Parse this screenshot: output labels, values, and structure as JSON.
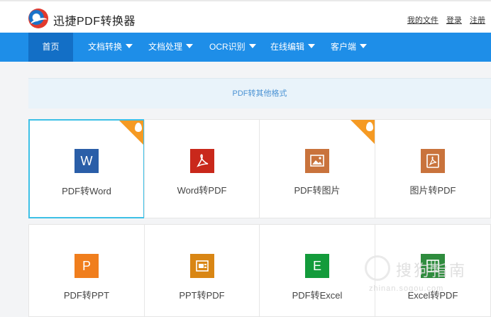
{
  "header": {
    "brand": "迅捷PDF转换器",
    "links": [
      "我的文件",
      "登录",
      "注册"
    ]
  },
  "nav": {
    "items": [
      {
        "label": "首页",
        "active": true,
        "dropdown": false
      },
      {
        "label": "文档转换",
        "dropdown": true
      },
      {
        "label": "文档处理",
        "dropdown": true
      },
      {
        "label": "OCR识别",
        "dropdown": true
      },
      {
        "label": "在线编辑",
        "dropdown": true
      },
      {
        "label": "客户端",
        "dropdown": true
      }
    ]
  },
  "banner": {
    "text": "PDF转其他格式"
  },
  "tools": [
    {
      "label": "PDF转Word",
      "icon": "word-icon",
      "glyph": "W",
      "color": "#2a5ea8",
      "hot": true,
      "selected": true
    },
    {
      "label": "Word转PDF",
      "icon": "pdf-icon",
      "glyph": "",
      "color": "#c9281b",
      "hot": false
    },
    {
      "label": "PDF转图片",
      "icon": "image-icon",
      "glyph": "",
      "color": "#c9733c",
      "hot": true
    },
    {
      "label": "图片转PDF",
      "icon": "pdf-icon",
      "glyph": "",
      "color": "#c9733c",
      "hot": false
    },
    {
      "label": "PDF转PPT",
      "icon": "ppt-icon",
      "glyph": "P",
      "color": "#f07e1d",
      "hot": false
    },
    {
      "label": "PPT转PDF",
      "icon": "ppt-pdf-icon",
      "glyph": "",
      "color": "#d98614",
      "hot": false
    },
    {
      "label": "PDF转Excel",
      "icon": "excel-icon",
      "glyph": "E",
      "color": "#139b3b",
      "hot": false
    },
    {
      "label": "Excel转PDF",
      "icon": "excel-pdf-icon",
      "glyph": "",
      "color": "#2f8c3e",
      "hot": false
    }
  ],
  "watermark": {
    "text": "搜狗指南",
    "sub": "zhinan.sogou.com"
  }
}
